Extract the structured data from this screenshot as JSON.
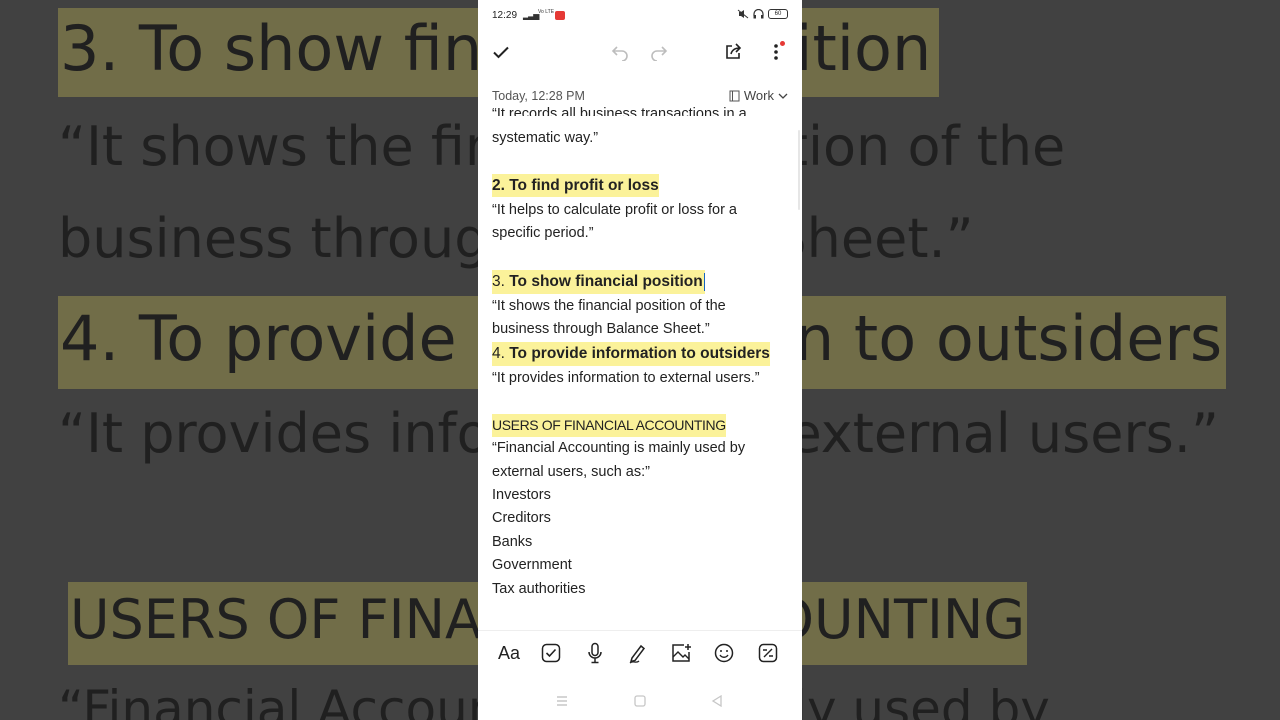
{
  "background": {
    "lines": [
      {
        "text": "3. To show financial position",
        "highlight": true
      },
      {
        "text": "“It shows the financial position of the",
        "highlight": false
      },
      {
        "text": "business through Balance Sheet.”",
        "highlight": false
      },
      {
        "text": "4. To provide information to outsiders",
        "highlight": true
      },
      {
        "text": "“It provides information to external users.”",
        "highlight": false
      },
      {
        "text": "USERS OF FINANCIAL ACCOUNTING",
        "highlight": true
      },
      {
        "text": "“Financial Accounting is mainly used by",
        "highlight": false
      }
    ]
  },
  "status_bar": {
    "time": "12:29",
    "network": "Vo LTE",
    "notification_badge": "",
    "battery": "60"
  },
  "meta": {
    "date": "Today, 12:28 PM",
    "folder": "Work"
  },
  "note": {
    "line_01": "“It records all business transactions in a",
    "line_02": "systematic way.”",
    "heading_2": "2. To find profit or loss",
    "line_03": "“It helps to calculate profit or loss for a",
    "line_04": "specific period.”",
    "heading_3_num": "3.",
    "heading_3_text": " To show financial position",
    "line_05": "“It shows the financial position of the",
    "line_06": "business through Balance Sheet.”",
    "heading_4_num": "4.",
    "heading_4_text": " To provide information to outsiders",
    "line_07": "“It provides information to external users.”",
    "heading_users": " USERS OF FINANCIAL ACCOUNTING",
    "line_08": "“Financial Accounting is mainly used by",
    "line_09": "external users, such as:”",
    "list": [
      "Investors",
      "Creditors",
      "Banks",
      "Government",
      "Tax authorities"
    ]
  },
  "bottom_toolbar": {
    "format_label": "Aa"
  },
  "colors": {
    "highlight": "#fbf29a",
    "cursor": "#1565c0",
    "accent_dot": "#e53935"
  }
}
